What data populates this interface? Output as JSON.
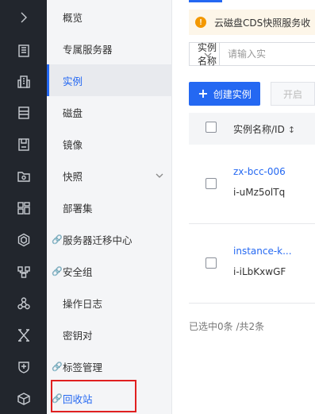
{
  "rail": {
    "icons": [
      "chevron-right-icon",
      "server-icon",
      "building-icon",
      "storage-icon",
      "disk-icon",
      "image-folder-icon",
      "dashboard-icon",
      "hexagon-icon",
      "network-icon",
      "cluster-icon",
      "x-shape-icon",
      "shield-icon",
      "box-icon"
    ]
  },
  "subnav": {
    "items": [
      {
        "label": "概览"
      },
      {
        "label": "专属服务器"
      },
      {
        "label": "实例"
      },
      {
        "label": "磁盘"
      },
      {
        "label": "镜像"
      },
      {
        "label": "快照"
      },
      {
        "label": "部署集"
      },
      {
        "label": "服务器迁移中心"
      },
      {
        "label": "安全组"
      },
      {
        "label": "操作日志"
      },
      {
        "label": "密钥对"
      },
      {
        "label": "标签管理"
      },
      {
        "label": "回收站"
      }
    ]
  },
  "main": {
    "notice": "云磁盘CDS快照服务收",
    "search": {
      "select_value": "实例名称",
      "placeholder": "请输入实"
    },
    "create_button": "创建实例",
    "start_button": "开启",
    "table": {
      "header_name": "实例名称/ID",
      "rows": [
        {
          "name": "zx-bcc-006",
          "id": "i-uMz5olTq"
        },
        {
          "name": "instance-k...",
          "id": "i-iLbKxwGF"
        }
      ]
    },
    "footer": "已选中0条 /共2条"
  },
  "colors": {
    "accent": "#2468f2",
    "rail_bg": "#22262d",
    "highlight_border": "#e02020",
    "warning": "#f39800"
  }
}
